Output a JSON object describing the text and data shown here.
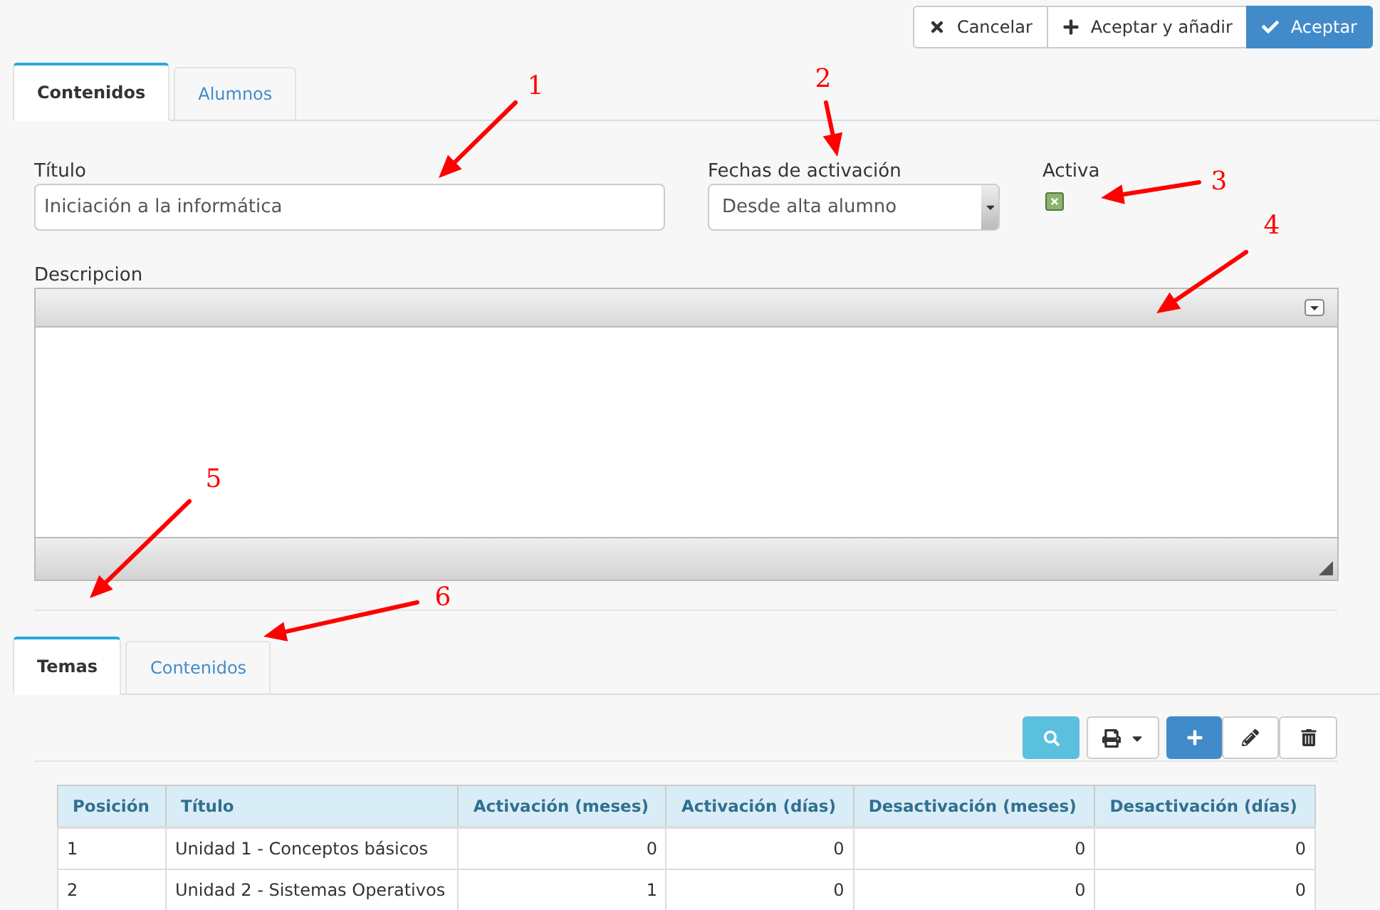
{
  "actions": [
    {
      "kind": "cancel",
      "label": "Cancelar"
    },
    {
      "kind": "add",
      "label": "Aceptar y añadir"
    },
    {
      "kind": "accept",
      "label": "Aceptar"
    }
  ],
  "main_tabs": [
    {
      "label": "Contenidos",
      "selected": true
    },
    {
      "label": "Alumnos",
      "selected": false
    }
  ],
  "form": {
    "titulo": {
      "label": "Título",
      "value": "Iniciación a la informática"
    },
    "fechas": {
      "label": "Fechas de activación",
      "value": "Desde alta alumno"
    },
    "activa": {
      "label": "Activa",
      "checked": true
    },
    "descripcion": {
      "label": "Descripcion"
    }
  },
  "sub_tabs": [
    {
      "label": "Temas",
      "selected": true
    },
    {
      "label": "Contenidos",
      "selected": false
    }
  ],
  "table_toolbar": [
    {
      "kind": "search"
    },
    {
      "kind": "print"
    },
    {
      "kind": "add"
    },
    {
      "kind": "edit"
    },
    {
      "kind": "delete"
    }
  ],
  "table": {
    "columns": [
      {
        "label": "Posición",
        "kind": "text"
      },
      {
        "label": "Título",
        "kind": "text"
      },
      {
        "label": "Activación (meses)",
        "kind": "number"
      },
      {
        "label": "Activación (días)",
        "kind": "number"
      },
      {
        "label": "Desactivación (meses)",
        "kind": "number"
      },
      {
        "label": "Desactivación (días)",
        "kind": "number"
      }
    ],
    "rows": [
      [
        "1",
        "Unidad 1 - Conceptos básicos",
        "0",
        "0",
        "0",
        "0"
      ],
      [
        "2",
        "Unidad 2 - Sistemas Operativos",
        "1",
        "0",
        "0",
        "0"
      ]
    ]
  },
  "annotations": [
    {
      "label": "1"
    },
    {
      "label": "2"
    },
    {
      "label": "3"
    },
    {
      "label": "4"
    },
    {
      "label": "5"
    },
    {
      "label": "6"
    }
  ]
}
